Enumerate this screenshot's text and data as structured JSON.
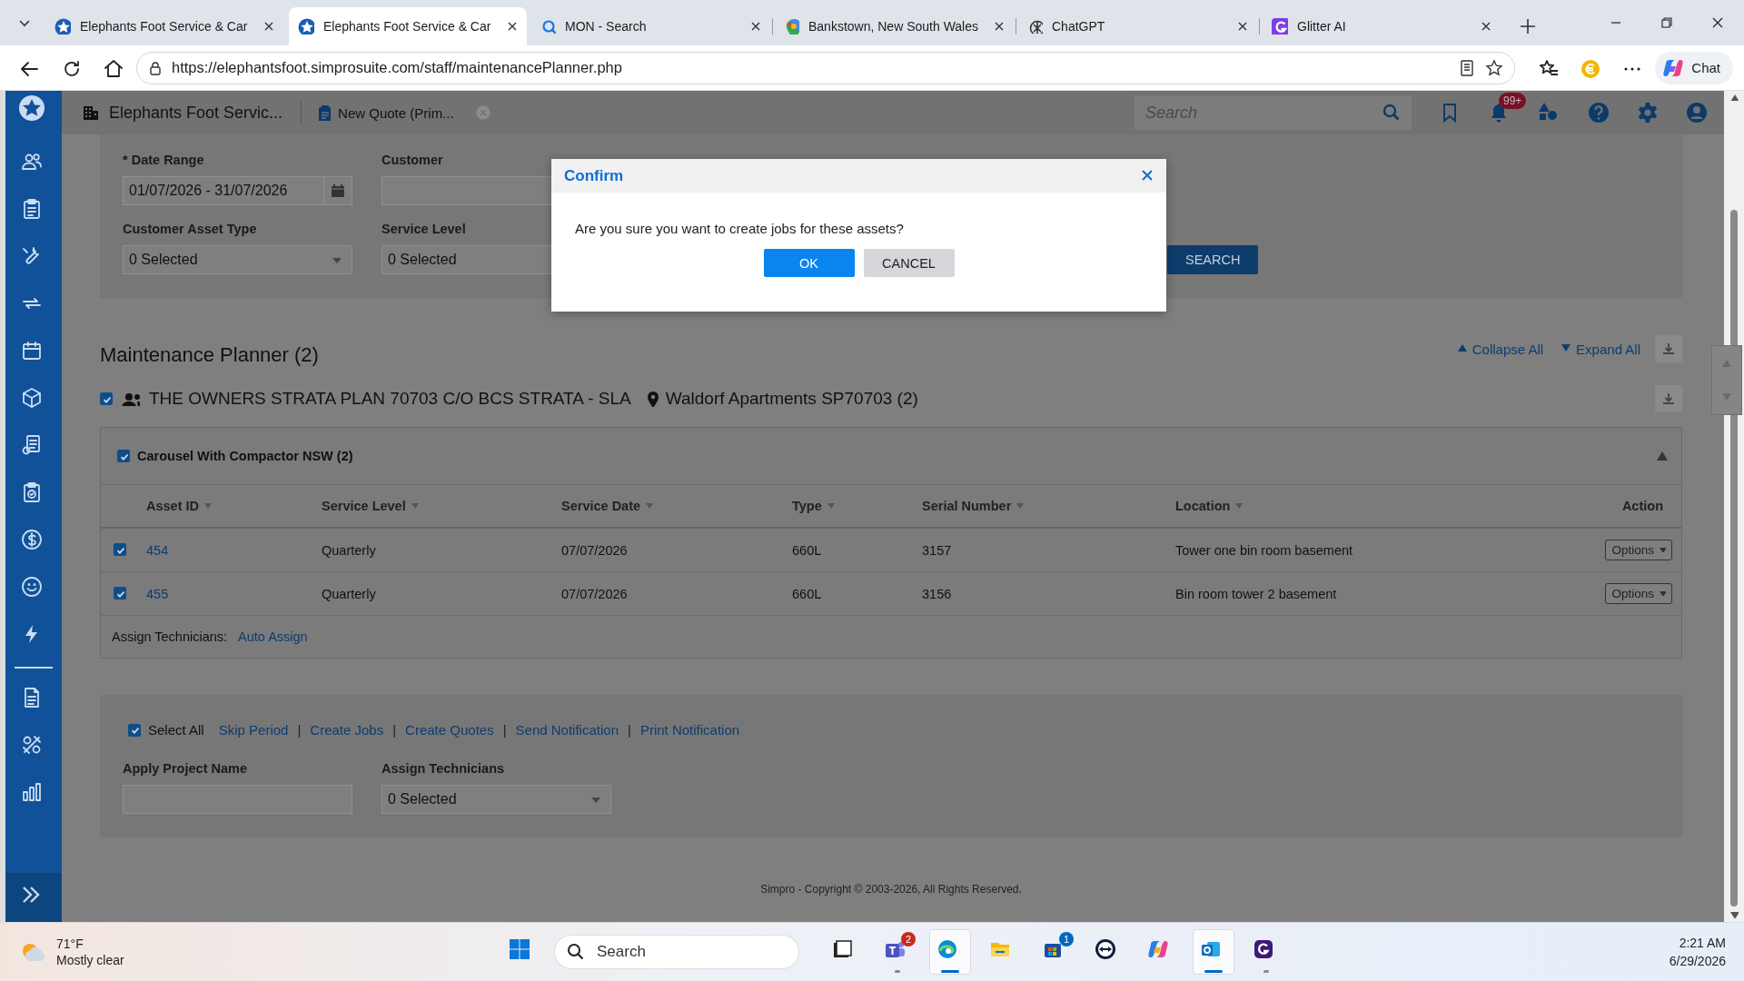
{
  "browser": {
    "tabs": [
      {
        "kind": "simpro",
        "title": "Elephants Foot Service & Car",
        "selected": false
      },
      {
        "kind": "simpro",
        "title": "Elephants Foot Service & Car",
        "selected": true
      },
      {
        "kind": "search",
        "title": "MON - Search",
        "selected": false
      },
      {
        "kind": "maps",
        "title": "Bankstown, New South Wales",
        "selected": false
      },
      {
        "kind": "chatgpt",
        "title": "ChatGPT",
        "selected": false
      },
      {
        "kind": "glitter",
        "title": "Glitter AI",
        "selected": false
      }
    ],
    "url": "https://elephantsfoot.simprosuite.com/staff/maintenancePlanner.php",
    "chat_label": "Chat"
  },
  "header": {
    "company": "Elephants Foot Servic...",
    "open_tab": "New Quote (Prim...",
    "search_placeholder": "Search",
    "notification_count": "99+"
  },
  "filters": [
    {
      "label": "* Date Range",
      "value": "01/07/2026 - 31/07/2026",
      "kind": "date"
    },
    {
      "label": "Customer",
      "kind": "text"
    },
    {
      "label": "Customer Asset Type",
      "value": "0 Selected",
      "kind": "select"
    },
    {
      "label": "Service Level",
      "value": "0 Selected",
      "kind": "select"
    }
  ],
  "search_button": "SEARCH",
  "planner": {
    "title": "Maintenance Planner (2)",
    "collapse_all": "Collapse All",
    "expand_all": "Expand All",
    "customer": {
      "checked": true,
      "name": "THE OWNERS STRATA PLAN 70703 C/O BCS STRATA - SLA",
      "site": "Waldorf Apartments SP70703 (2)"
    },
    "group": {
      "checked": true,
      "name": "Carousel With Compactor NSW (2)"
    },
    "columns": [
      "Asset ID",
      "Service Level",
      "Service Date",
      "Type",
      "Serial Number",
      "Location",
      "Action"
    ],
    "rows": [
      {
        "checked": true,
        "asset_id": "454",
        "service_level": "Quarterly",
        "service_date": "07/07/2026",
        "type": "660L",
        "serial_number": "3157",
        "location": "Tower one bin room basement",
        "action": "Options"
      },
      {
        "checked": true,
        "asset_id": "455",
        "service_level": "Quarterly",
        "service_date": "07/07/2026",
        "type": "660L",
        "serial_number": "3156",
        "location": "Bin room tower 2 basement",
        "action": "Options"
      }
    ],
    "assign_label": "Assign Technicians:",
    "auto_assign": "Auto Assign"
  },
  "bulk": {
    "select_all": {
      "label": "Select All",
      "checked": true
    },
    "link_separator": "|",
    "links": [
      "Skip Period",
      "Create Jobs",
      "Create Quotes",
      "Send Notification",
      "Print Notification"
    ],
    "fields": [
      {
        "label": "Apply Project Name",
        "kind": "text"
      },
      {
        "label": "Assign Technicians",
        "value": "0 Selected",
        "kind": "select"
      }
    ]
  },
  "footer": "Simpro - Copyright © 2003-2026, All Rights Reserved.",
  "dialog": {
    "title": "Confirm",
    "message": "Are you sure you want to create jobs for these assets?",
    "buttons": [
      {
        "label": "OK",
        "kind": "primary"
      },
      {
        "label": "CANCEL",
        "kind": "secondary"
      }
    ]
  },
  "taskbar": {
    "weather": {
      "temperature": "71°F",
      "condition": "Mostly clear"
    },
    "search_placeholder": "Search",
    "apps": [
      {
        "kind": "taskview",
        "open": false,
        "selected": false
      },
      {
        "kind": "teams",
        "badge": "2",
        "open": true,
        "selected": false
      },
      {
        "kind": "edge",
        "open": true,
        "selected": true
      },
      {
        "kind": "files",
        "open": false,
        "selected": false
      },
      {
        "kind": "store",
        "badge": "1",
        "open": false,
        "selected": false
      },
      {
        "kind": "teamviewer",
        "open": false,
        "selected": false
      },
      {
        "kind": "copilot",
        "open": false,
        "selected": false
      },
      {
        "kind": "outlook",
        "open": true,
        "selected": true
      },
      {
        "kind": "glitter",
        "open": true,
        "selected": false
      }
    ],
    "time": "2:21 AM",
    "date": "6/29/2026"
  }
}
